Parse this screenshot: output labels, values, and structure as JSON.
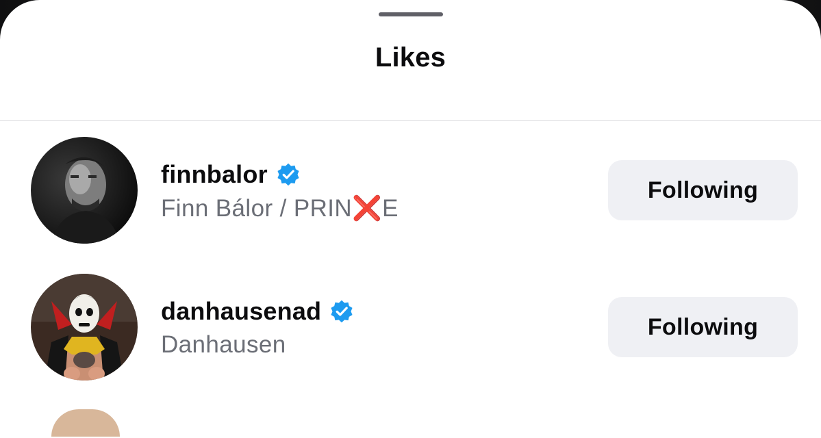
{
  "sheet": {
    "title": "Likes"
  },
  "likes": [
    {
      "username": "finnbalor",
      "verified": true,
      "full_name": "Finn Bálor  /  PRIN❌E",
      "button_label": "Following",
      "avatar": "finnbalor-avatar-photo"
    },
    {
      "username": "danhausenad",
      "verified": true,
      "full_name": "Danhausen",
      "button_label": "Following",
      "avatar": "danhausenad-avatar-photo"
    }
  ],
  "icons": {
    "verified": "verified-badge-icon"
  },
  "colors": {
    "verified_blue": "#1d9bf0",
    "button_bg": "#eff0f4",
    "secondary_text": "#6b6e76"
  }
}
